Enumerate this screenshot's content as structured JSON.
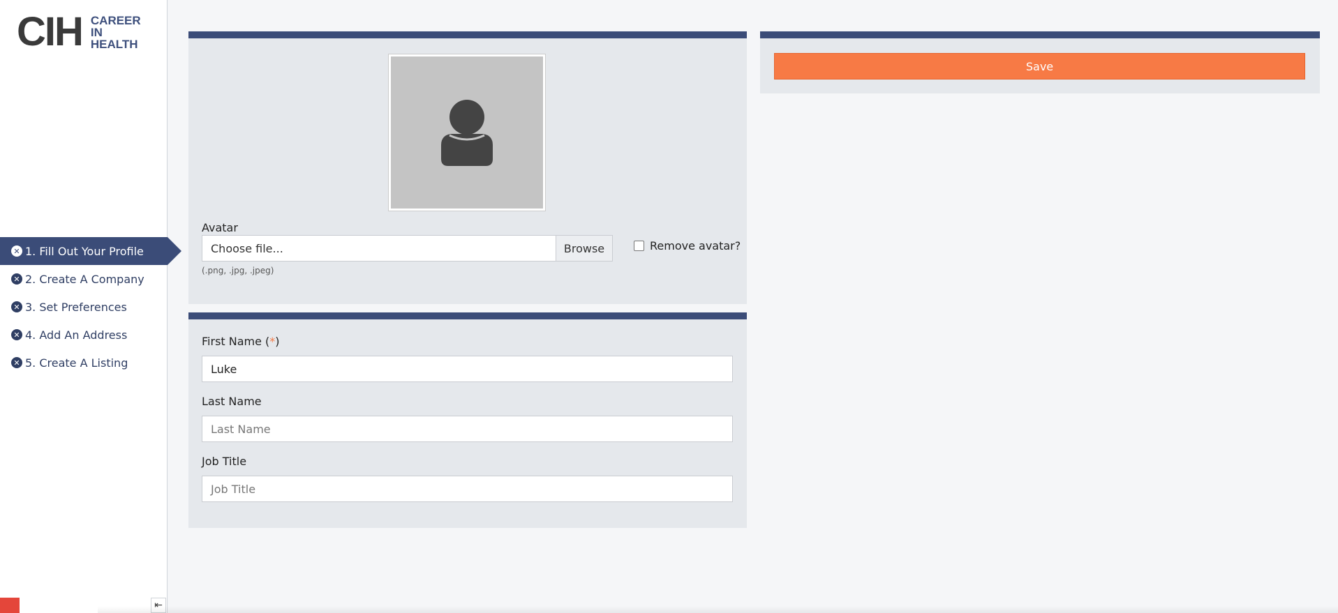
{
  "logo": {
    "short": "CIH",
    "line1": "CAREER",
    "line2": "IN",
    "line3": "HEALTH"
  },
  "steps": [
    {
      "label": "1. Fill Out Your Profile",
      "active": true
    },
    {
      "label": "2. Create A Company"
    },
    {
      "label": "3. Set Preferences"
    },
    {
      "label": "4. Add An Address"
    },
    {
      "label": "5. Create A Listing"
    }
  ],
  "avatar": {
    "label": "Avatar",
    "file_value": "Choose file...",
    "browse_label": "Browse",
    "hint": "(.png, .jpg, .jpeg)",
    "remove_label": "Remove avatar?"
  },
  "form": {
    "first_name_label": "First Name (",
    "first_name_req": "*",
    "first_name_close": ")",
    "first_name_value": "Luke",
    "last_name_label": "Last Name",
    "last_name_placeholder": "Last Name",
    "job_title_label": "Job Title",
    "job_title_placeholder": "Job Title"
  },
  "actions": {
    "save_label": "Save"
  },
  "colors": {
    "accent": "#f77a45",
    "brand": "#3b4c78"
  }
}
